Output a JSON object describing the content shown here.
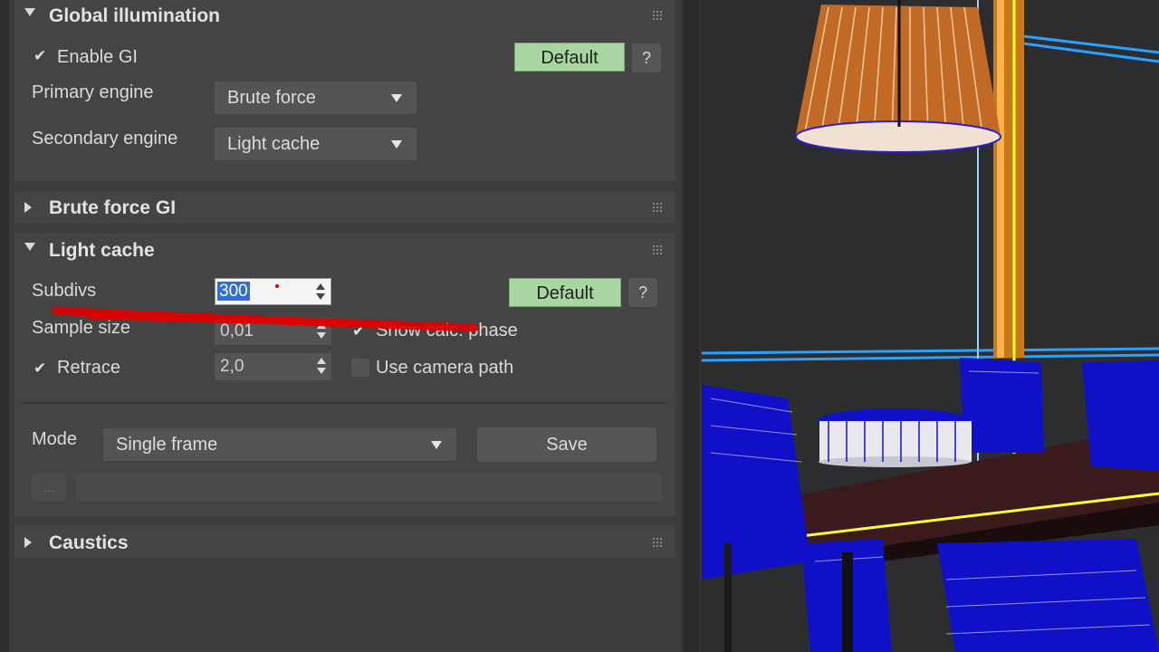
{
  "gi_rollout": {
    "title": "Global illumination",
    "enable_gi_label": "Enable GI",
    "enable_gi_checked": true,
    "default_label": "Default",
    "help_label": "?",
    "primary_engine_label": "Primary engine",
    "primary_engine_value": "Brute force",
    "secondary_engine_label": "Secondary engine",
    "secondary_engine_value": "Light cache"
  },
  "brute_force_rollout": {
    "title": "Brute force GI"
  },
  "light_cache_rollout": {
    "title": "Light cache",
    "subdivs_label": "Subdivs",
    "subdivs_value": "300",
    "default_label": "Default",
    "help_label": "?",
    "sample_size_label": "Sample size",
    "sample_size_value": "0,01",
    "show_calc_phase_label": "Show calc. phase",
    "show_calc_phase_checked": true,
    "retrace_label": "Retrace",
    "retrace_checked": true,
    "retrace_value": "2,0",
    "use_camera_path_label": "Use camera path",
    "use_camera_path_checked": false,
    "mode_label": "Mode",
    "mode_value": "Single frame",
    "save_label": "Save",
    "browse_label": "..."
  },
  "caustics_rollout": {
    "title": "Caustics"
  },
  "colors": {
    "panel_bg": "#3c3c3c",
    "rollout_bg": "#444444",
    "default_button": "#a8d6a0",
    "selection": "#2f6fd8",
    "annotation_red": "#e00000",
    "wireframe_blue": "#1010c8",
    "highlight_yellow": "#ffff33"
  }
}
